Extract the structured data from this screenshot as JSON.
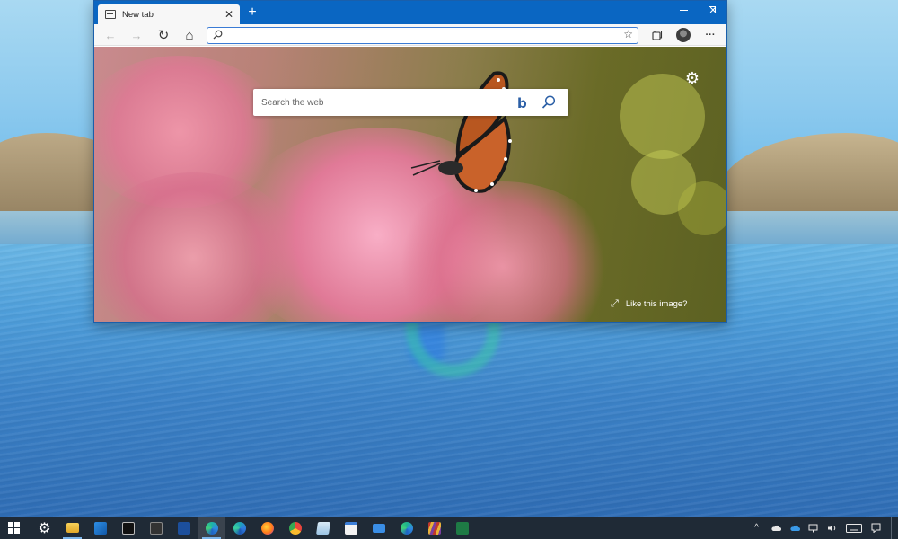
{
  "browser": {
    "tab": {
      "title": "New tab",
      "close_glyph": "✕"
    },
    "new_tab_glyph": "+",
    "window_controls": {
      "minimize": "minimize-icon",
      "maximize": "maximize-icon",
      "close": "✕"
    },
    "toolbar": {
      "back_glyph": "←",
      "forward_glyph": "→",
      "refresh_glyph": "↻",
      "home_glyph": "⌂",
      "address": {
        "value": "",
        "placeholder": ""
      },
      "favorite_glyph": "☆",
      "collections_icon": "collections-icon",
      "more_glyph": "···"
    }
  },
  "new_tab_page": {
    "search": {
      "placeholder": "Search the web",
      "bing_glyph": "b"
    },
    "settings_glyph": "⚙",
    "like_image": {
      "expand_glyph": "⤢",
      "label": "Like this image?"
    }
  },
  "taskbar": {
    "apps": [
      {
        "name": "start",
        "icon": "windows-logo-icon"
      },
      {
        "name": "settings",
        "icon": "gear-icon",
        "glyph": "⚙"
      },
      {
        "name": "file-explorer",
        "icon": "folder-icon"
      },
      {
        "name": "photos",
        "icon": "photos-icon"
      },
      {
        "name": "command-prompt",
        "icon": "cmd-icon"
      },
      {
        "name": "terminal",
        "icon": "terminal-icon"
      },
      {
        "name": "powershell",
        "icon": "powershell-icon"
      },
      {
        "name": "edge",
        "icon": "edge-icon",
        "active": true
      },
      {
        "name": "edge-beta",
        "icon": "edge-beta-icon"
      },
      {
        "name": "firefox",
        "icon": "firefox-icon"
      },
      {
        "name": "chrome",
        "icon": "chrome-icon"
      },
      {
        "name": "notepad",
        "icon": "notepad-icon"
      },
      {
        "name": "store",
        "icon": "store-icon"
      },
      {
        "name": "mail",
        "icon": "mail-icon"
      },
      {
        "name": "edge-dev",
        "icon": "edge-dev-icon"
      },
      {
        "name": "winrar",
        "icon": "winrar-icon"
      },
      {
        "name": "excel",
        "icon": "excel-icon"
      }
    ],
    "tray": {
      "chevron_glyph": "^",
      "items": [
        "cloud-icon",
        "onedrive-icon",
        "network-icon",
        "volume-icon",
        "keyboard-icon",
        "notifications-icon"
      ]
    }
  },
  "colors": {
    "titlebar": "#0a66c2",
    "taskbar": "#1f2a36",
    "accent": "#3a7bd5"
  }
}
